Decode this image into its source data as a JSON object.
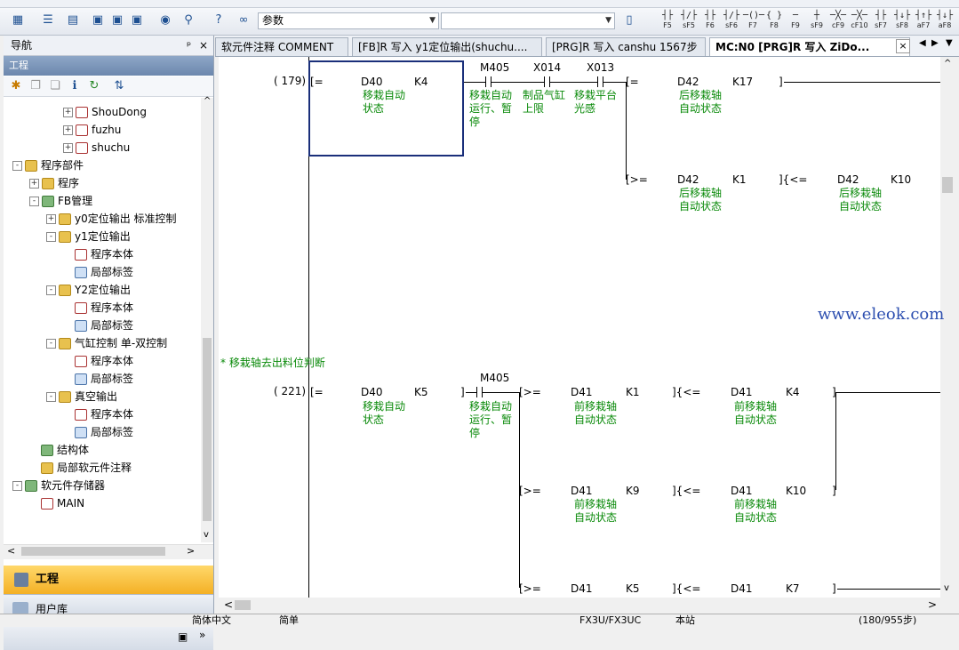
{
  "toolbar": {
    "combo1_value": "参数",
    "combo2_value": "",
    "fkeys": [
      "F5",
      "sF5",
      "F6",
      "sF6",
      "F7",
      "F8",
      "F9",
      "sF9",
      "cF9",
      "cF10",
      "sF7",
      "sF8",
      "aF7",
      "aF8"
    ]
  },
  "nav": {
    "title": "导航",
    "pin": "ᵖ",
    "close": "×",
    "project_header": "工程",
    "tree": [
      {
        "label": "ShouDong",
        "level": 3,
        "icon": "prog",
        "exp": "+"
      },
      {
        "label": "fuzhu",
        "level": 3,
        "icon": "prog",
        "exp": "+"
      },
      {
        "label": "shuchu",
        "level": 3,
        "icon": "prog",
        "exp": "+"
      },
      {
        "label": "程序部件",
        "level": 0,
        "icon": "folder",
        "exp": "-"
      },
      {
        "label": "程序",
        "level": 1,
        "icon": "folder",
        "exp": "+"
      },
      {
        "label": "FB管理",
        "level": 1,
        "icon": "gear",
        "exp": "-"
      },
      {
        "label": "y0定位输出 标准控制",
        "level": 2,
        "icon": "folder",
        "exp": "+"
      },
      {
        "label": "y1定位输出",
        "level": 2,
        "icon": "folder",
        "exp": "-"
      },
      {
        "label": "程序本体",
        "level": 3,
        "icon": "prog",
        "exp": ""
      },
      {
        "label": "局部标签",
        "level": 3,
        "icon": "label",
        "exp": ""
      },
      {
        "label": "Y2定位输出",
        "level": 2,
        "icon": "folder",
        "exp": "-"
      },
      {
        "label": "程序本体",
        "level": 3,
        "icon": "prog",
        "exp": ""
      },
      {
        "label": "局部标签",
        "level": 3,
        "icon": "label",
        "exp": ""
      },
      {
        "label": "气缸控制 单-双控制",
        "level": 2,
        "icon": "folder",
        "exp": "-"
      },
      {
        "label": "程序本体",
        "level": 3,
        "icon": "prog",
        "exp": ""
      },
      {
        "label": "局部标签",
        "level": 3,
        "icon": "label",
        "exp": ""
      },
      {
        "label": "真空输出",
        "level": 2,
        "icon": "folder",
        "exp": "-"
      },
      {
        "label": "程序本体",
        "level": 3,
        "icon": "prog",
        "exp": ""
      },
      {
        "label": "局部标签",
        "level": 3,
        "icon": "label",
        "exp": ""
      },
      {
        "label": "结构体",
        "level": 1,
        "icon": "gear",
        "exp": ""
      },
      {
        "label": "局部软元件注释",
        "level": 1,
        "icon": "folder",
        "exp": ""
      },
      {
        "label": "软元件存储器",
        "level": 0,
        "icon": "gear",
        "exp": "-"
      },
      {
        "label": "MAIN",
        "level": 1,
        "icon": "prog",
        "exp": ""
      }
    ],
    "pane_project": "工程",
    "pane_library": "用户库"
  },
  "tabs": [
    {
      "label": "软元件注释 COMMENT",
      "active": false
    },
    {
      "label": "[FB]R 写入 y1定位输出(shuchu....",
      "active": false
    },
    {
      "label": "[PRG]R 写入 canshu 1567步",
      "active": false
    },
    {
      "label": "MC:N0 [PRG]R 写入 ZiDo...",
      "active": true
    }
  ],
  "ladder": {
    "rung1_step": "( 179)",
    "rung2_step": "( 221)",
    "section_comment": "* 移栽轴去出料位判断",
    "watermark": "www.eleok.com",
    "eq_open": "[=",
    "ge_open": "[>=",
    "le_mid": "]{<=",
    "ge_b": "[>=",
    "close": "]",
    "r1": {
      "cmp_dev": "D40",
      "cmp_val": "K4",
      "cmp_cmt": "移栽自动\n状态",
      "c1": "M405",
      "c1_cmt": "移栽自动\n运行、暂\n停",
      "c2": "X014",
      "c2_cmt": "制品气缸\n上限",
      "c3": "X013",
      "c3_cmt": "移栽平台\n光感",
      "out1_dev": "D42",
      "out1_val": "K17",
      "out1_cmt": "后移栽轴\n自动状态",
      "out2a_dev": "D42",
      "out2a_val": "K1",
      "out2a_cmt": "后移栽轴\n自动状态",
      "out2b_dev": "D42",
      "out2b_val": "K10",
      "out2b_cmt": "后移栽轴\n自动状态"
    },
    "r2": {
      "cmp_dev": "D40",
      "cmp_val": "K5",
      "cmp_cmt": "移栽自动\n状态",
      "c1": "M405",
      "c1_cmt": "移栽自动\n运行、暂\n停",
      "a1_dev": "D41",
      "a1_val": "K1",
      "a1_cmt": "前移栽轴\n自动状态",
      "a2_dev": "D41",
      "a2_val": "K4",
      "a2_cmt": "前移栽轴\n自动状态",
      "b1_dev": "D41",
      "b1_val": "K9",
      "b1_cmt": "前移栽轴\n自动状态",
      "b2_dev": "D41",
      "b2_val": "K10",
      "b2_cmt": "前移栽轴\n自动状态",
      "c1_dev": "D41",
      "c1_val": "K5",
      "c2_dev": "D41",
      "c2_val": "K7"
    }
  },
  "status": {
    "lang": "简体中文",
    "mode": "简单",
    "plc": "FX3U/FX3UC",
    "station": "本站",
    "steps": "(180/955步)"
  }
}
